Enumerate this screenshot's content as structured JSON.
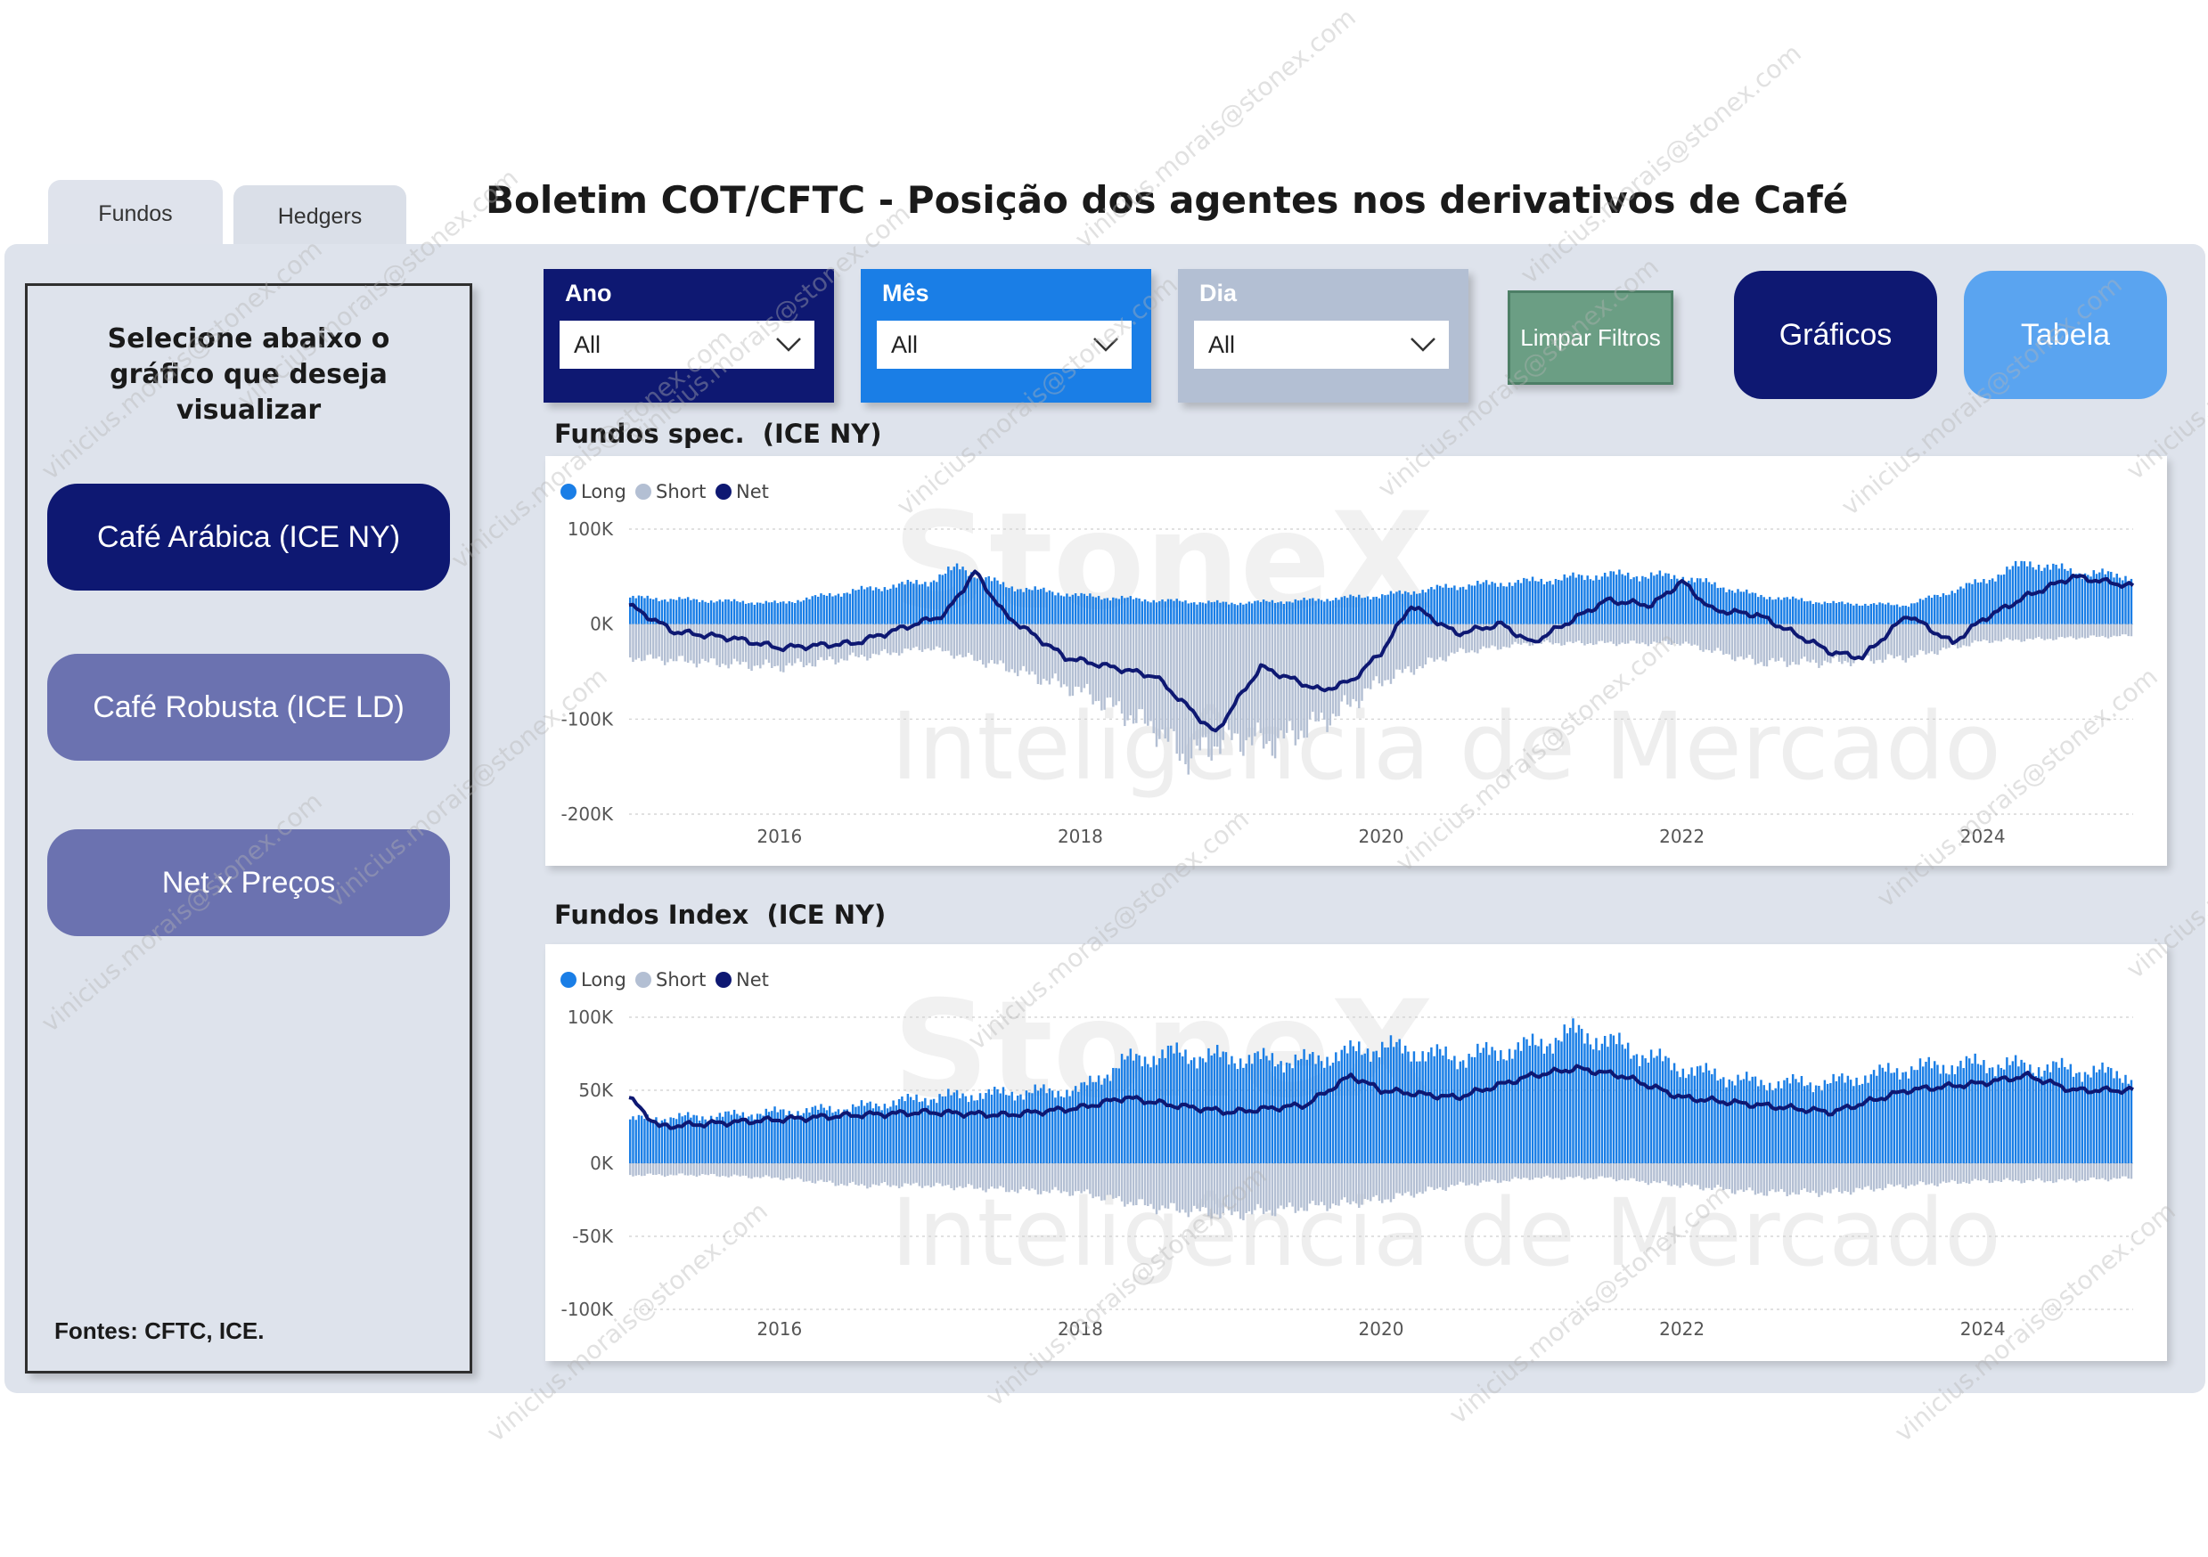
{
  "tabs": [
    {
      "label": "Fundos",
      "active": true
    },
    {
      "label": "Hedgers",
      "active": false
    }
  ],
  "header": {
    "title": "Boletim COT/CFTC - Posição dos agentes nos derivativos de Café"
  },
  "sidebar": {
    "select_title": "Selecione abaixo o gráfico que deseja visualizar",
    "buttons": [
      {
        "label": "Café Arábica (ICE NY)",
        "active": true
      },
      {
        "label": "Café Robusta (ICE LD)",
        "active": false
      },
      {
        "label": "Net x Preços",
        "active": false
      }
    ],
    "sources": "Fontes: CFTC, ICE."
  },
  "filters": [
    {
      "label": "Ano",
      "value": "All"
    },
    {
      "label": "Mês",
      "value": "All"
    },
    {
      "label": "Dia",
      "value": "All"
    }
  ],
  "actions": {
    "clear_label": "Limpar Filtros",
    "charts_label": "Gráficos",
    "table_label": "Tabela"
  },
  "watermark": {
    "brand": "StoneX",
    "tagline": "Inteligência de Mercado",
    "email": "vinicius.morais@stonex.com"
  },
  "colors": {
    "long": "#1a7ee6",
    "short": "#b3bfd3",
    "net": "#0e1872",
    "navy": "#0e1872",
    "purple": "#6b72b0",
    "green": "#6b9e84",
    "light_blue": "#5aa4f0"
  },
  "chart_data": [
    {
      "type": "bar",
      "title": "Fundos spec.  (ICE NY)",
      "legend": [
        "Long",
        "Short",
        "Net"
      ],
      "legend_position": "top-left",
      "grid": true,
      "ylim": [
        -200000,
        100000
      ],
      "yticks": [
        {
          "value": 100000,
          "label": "100K"
        },
        {
          "value": 0,
          "label": "0K"
        },
        {
          "value": -100000,
          "label": "-100K"
        },
        {
          "value": -200000,
          "label": "-200K"
        }
      ],
      "xlim": [
        2015.0,
        2025.0
      ],
      "xticks": [
        2016,
        2018,
        2020,
        2022,
        2024
      ],
      "series": [
        {
          "name": "Long",
          "x": [
            2015.0,
            2015.5,
            2016.0,
            2016.5,
            2017.0,
            2017.2,
            2017.5,
            2018.0,
            2018.5,
            2019.0,
            2019.5,
            2020.0,
            2020.5,
            2021.0,
            2021.5,
            2022.0,
            2022.5,
            2023.0,
            2023.5,
            2024.0,
            2024.3,
            2024.6,
            2025.0
          ],
          "values": [
            28000,
            25000,
            22000,
            35000,
            45000,
            60000,
            40000,
            30000,
            25000,
            22000,
            25000,
            30000,
            40000,
            45000,
            52000,
            50000,
            30000,
            22000,
            20000,
            45000,
            65000,
            55000,
            50000
          ]
        },
        {
          "name": "Short",
          "x": [
            2015.0,
            2015.5,
            2016.0,
            2016.5,
            2017.0,
            2017.5,
            2018.0,
            2018.5,
            2018.7,
            2019.0,
            2019.3,
            2019.7,
            2020.0,
            2020.5,
            2021.0,
            2021.5,
            2022.0,
            2022.5,
            2023.0,
            2023.5,
            2024.0,
            2024.5,
            2025.0
          ],
          "values": [
            -35000,
            -40000,
            -45000,
            -35000,
            -25000,
            -45000,
            -70000,
            -110000,
            -140000,
            -120000,
            -125000,
            -95000,
            -60000,
            -30000,
            -20000,
            -20000,
            -20000,
            -40000,
            -40000,
            -35000,
            -18000,
            -15000,
            -12000
          ]
        },
        {
          "name": "Net",
          "x": [
            2015.0,
            2015.3,
            2015.7,
            2016.0,
            2016.5,
            2016.8,
            2017.1,
            2017.3,
            2017.5,
            2017.9,
            2018.2,
            2018.5,
            2018.8,
            2018.9,
            2019.0,
            2019.2,
            2019.6,
            2019.8,
            2020.0,
            2020.2,
            2020.5,
            2020.8,
            2021.0,
            2021.5,
            2021.8,
            2022.0,
            2022.2,
            2022.5,
            2023.0,
            2023.2,
            2023.5,
            2023.8,
            2024.0,
            2024.3,
            2024.6,
            2025.0
          ],
          "values": [
            20000,
            -8000,
            -15000,
            -25000,
            -20000,
            -5000,
            10000,
            55000,
            10000,
            -35000,
            -45000,
            -55000,
            -100000,
            -115000,
            -90000,
            -45000,
            -70000,
            -60000,
            -30000,
            20000,
            -10000,
            0,
            -20000,
            25000,
            20000,
            45000,
            15000,
            10000,
            -30000,
            -35000,
            10000,
            -20000,
            5000,
            30000,
            50000,
            40000
          ]
        }
      ]
    },
    {
      "type": "bar",
      "title": "Fundos Index  (ICE NY)",
      "legend": [
        "Long",
        "Short",
        "Net"
      ],
      "legend_position": "top-left",
      "grid": true,
      "ylim": [
        -100000,
        100000
      ],
      "yticks": [
        {
          "value": 100000,
          "label": "100K"
        },
        {
          "value": 50000,
          "label": "50K"
        },
        {
          "value": 0,
          "label": "0K"
        },
        {
          "value": -50000,
          "label": "-50K"
        },
        {
          "value": -100000,
          "label": "-100K"
        }
      ],
      "xlim": [
        2015.0,
        2025.0
      ],
      "xticks": [
        2016,
        2018,
        2020,
        2022,
        2024
      ],
      "series": [
        {
          "name": "Long",
          "x": [
            2015.0,
            2015.5,
            2016.0,
            2016.5,
            2017.0,
            2017.5,
            2018.0,
            2018.3,
            2018.6,
            2019.0,
            2019.5,
            2020.0,
            2020.5,
            2021.0,
            2021.3,
            2021.6,
            2022.0,
            2022.5,
            2023.0,
            2023.5,
            2024.0,
            2024.5,
            2025.0
          ],
          "values": [
            30000,
            32000,
            35000,
            38000,
            45000,
            48000,
            50000,
            70000,
            75000,
            72000,
            70000,
            80000,
            72000,
            80000,
            90000,
            80000,
            65000,
            55000,
            55000,
            65000,
            68000,
            65000,
            60000
          ]
        },
        {
          "name": "Short",
          "x": [
            2015.0,
            2015.5,
            2016.0,
            2016.5,
            2017.0,
            2017.5,
            2018.0,
            2018.5,
            2019.0,
            2019.5,
            2020.0,
            2020.5,
            2021.0,
            2021.5,
            2022.0,
            2022.5,
            2023.0,
            2023.5,
            2024.0,
            2024.5,
            2025.0
          ],
          "values": [
            -8000,
            -8000,
            -10000,
            -15000,
            -15000,
            -18000,
            -20000,
            -30000,
            -35000,
            -30000,
            -25000,
            -15000,
            -10000,
            -10000,
            -15000,
            -20000,
            -20000,
            -15000,
            -12000,
            -12000,
            -10000
          ]
        },
        {
          "name": "Net",
          "x": [
            2015.0,
            2015.2,
            2015.5,
            2016.0,
            2016.5,
            2017.0,
            2017.5,
            2018.0,
            2018.3,
            2018.6,
            2019.0,
            2019.5,
            2019.8,
            2020.0,
            2020.5,
            2021.0,
            2021.3,
            2021.6,
            2022.0,
            2022.5,
            2023.0,
            2023.5,
            2024.0,
            2024.3,
            2024.6,
            2025.0
          ],
          "values": [
            45000,
            25000,
            27000,
            30000,
            33000,
            35000,
            33000,
            38000,
            45000,
            40000,
            35000,
            40000,
            60000,
            50000,
            45000,
            60000,
            65000,
            60000,
            45000,
            40000,
            35000,
            50000,
            55000,
            60000,
            50000,
            50000
          ]
        }
      ]
    }
  ]
}
